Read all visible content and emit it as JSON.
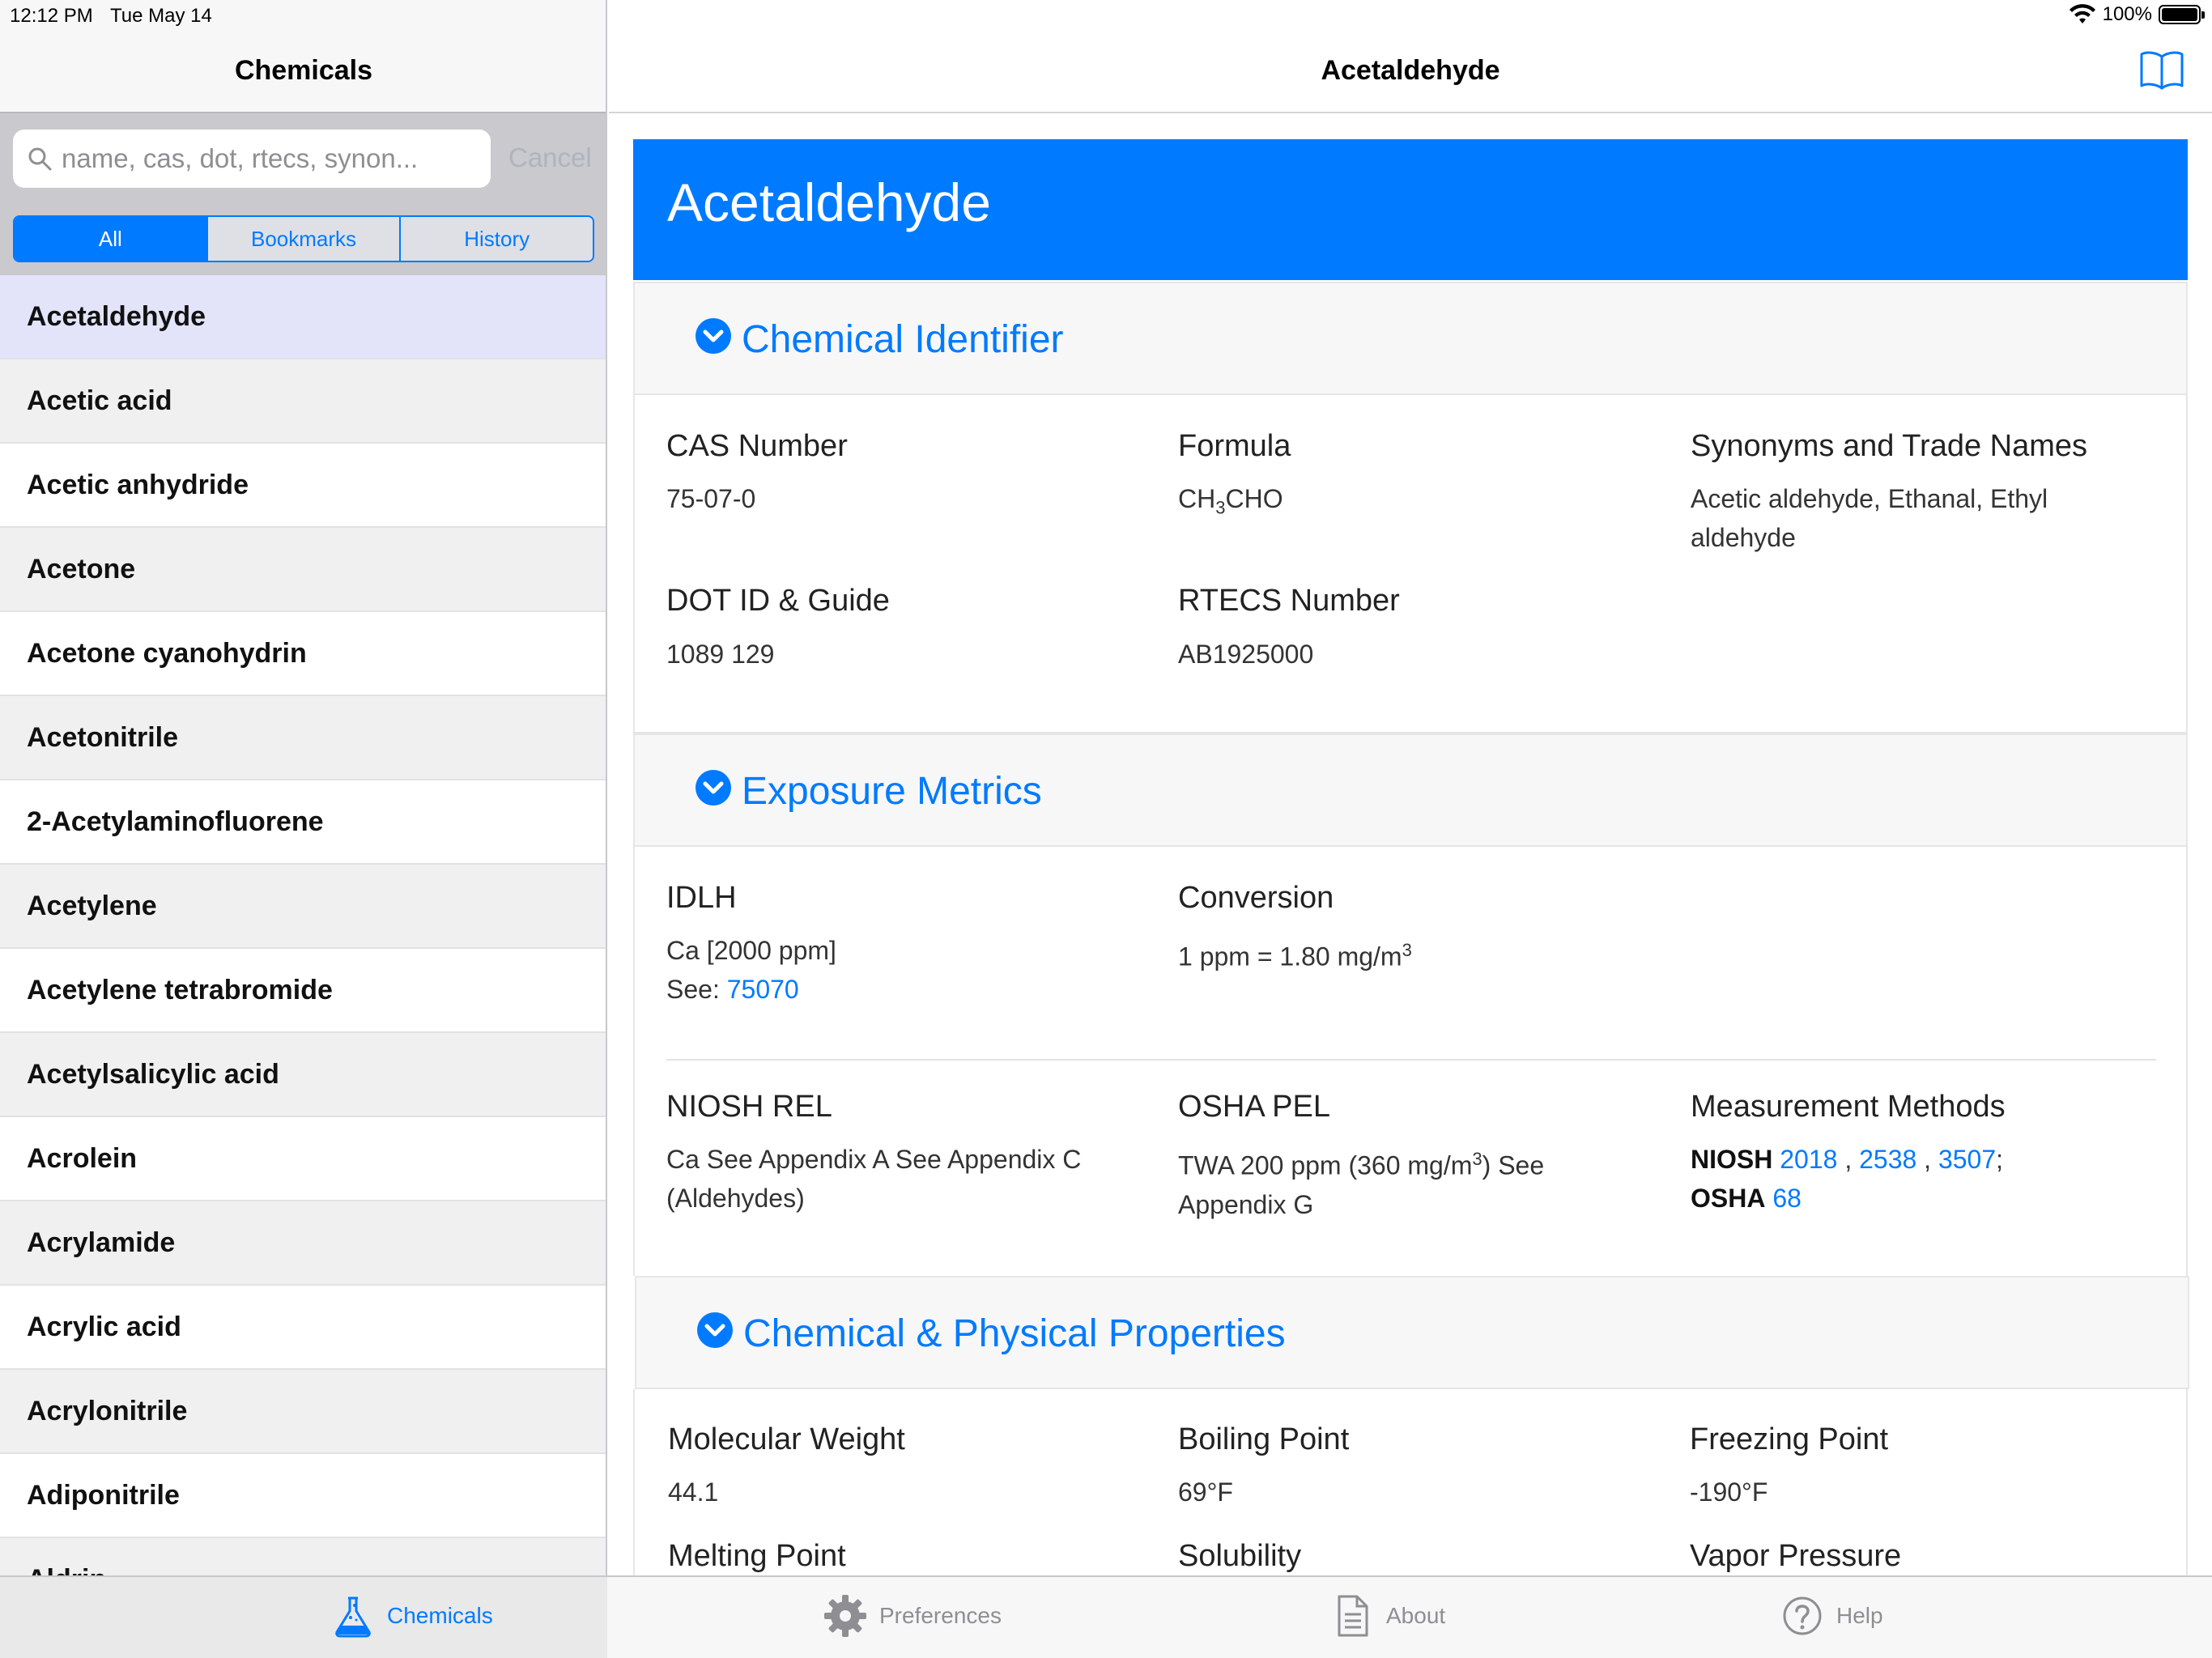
{
  "status_bar": {
    "time": "12:12 PM",
    "date": "Tue May 14",
    "battery": "100%"
  },
  "sidebar": {
    "title": "Chemicals",
    "search": {
      "placeholder": "name, cas, dot, rtecs, synon...",
      "cancel": "Cancel"
    },
    "segments": [
      "All",
      "Bookmarks",
      "History"
    ],
    "active_segment": "All",
    "items": [
      "Acetaldehyde",
      "Acetic acid",
      "Acetic anhydride",
      "Acetone",
      "Acetone cyanohydrin",
      "Acetonitrile",
      "2-Acetylaminofluorene",
      "Acetylene",
      "Acetylene tetrabromide",
      "Acetylsalicylic acid",
      "Acrolein",
      "Acrylamide",
      "Acrylic acid",
      "Acrylonitrile",
      "Adiponitrile",
      "Aldrin"
    ],
    "selected_item": "Acetaldehyde"
  },
  "detail": {
    "nav_title": "Acetaldehyde",
    "banner_title": "Acetaldehyde",
    "sections": {
      "identifier": {
        "title": "Chemical Identifier",
        "cas_label": "CAS Number",
        "cas_value": "75-07-0",
        "formula_label": "Formula",
        "formula_part1": "CH",
        "formula_sub": "3",
        "formula_part2": "CHO",
        "synonyms_label": "Synonyms and Trade Names",
        "synonyms_line1": "Acetic aldehyde, Ethanal, Ethyl",
        "synonyms_line2": "aldehyde",
        "dot_label": "DOT ID & Guide",
        "dot_value": "1089 129",
        "rtecs_label": "RTECS Number",
        "rtecs_value": "AB1925000"
      },
      "exposure": {
        "title": "Exposure Metrics",
        "idlh_label": "IDLH",
        "idlh_value": "Ca [2000 ppm]",
        "idlh_see": "See:",
        "idlh_link": "75070",
        "conversion_label": "Conversion",
        "conversion_value": "1 ppm = 1.80 mg/m",
        "conversion_sup": "3",
        "rel_label": "NIOSH REL",
        "rel_line1": "Ca See Appendix A See Appendix C",
        "rel_line2": "(Aldehydes)",
        "pel_label": "OSHA PEL",
        "pel_line1_a": "TWA 200 ppm (360 mg/m",
        "pel_line1_sup": "3",
        "pel_line1_b": ") See",
        "pel_line2": "Appendix G",
        "methods_label": "Measurement Methods",
        "methods_niosh": "NIOSH",
        "methods_link1": "2018",
        "methods_comma1": ",",
        "methods_link2": "2538",
        "methods_comma2": ",",
        "methods_link3": "3507",
        "methods_semicolon": ";",
        "methods_osha": "OSHA",
        "methods_link4": "68"
      },
      "properties": {
        "title": "Chemical & Physical Properties",
        "mw_label": "Molecular Weight",
        "mw_value": "44.1",
        "bp_label": "Boiling Point",
        "bp_value": "69°F",
        "fp_label": "Freezing Point",
        "fp_value": "-190°F",
        "mp_label": "Melting Point",
        "sol_label": "Solubility",
        "vp_label": "Vapor Pressure"
      }
    }
  },
  "tab_bar": {
    "tabs": [
      {
        "label": "Chemicals",
        "icon": "flask-icon"
      },
      {
        "label": "Preferences",
        "icon": "gear-icon"
      },
      {
        "label": "About",
        "icon": "document-icon"
      },
      {
        "label": "Help",
        "icon": "question-icon"
      }
    ],
    "active": "Chemicals"
  },
  "colors": {
    "accent": "#007aff",
    "selected_row": "#e3e3f9",
    "search_bg": "#c9c9ce"
  }
}
